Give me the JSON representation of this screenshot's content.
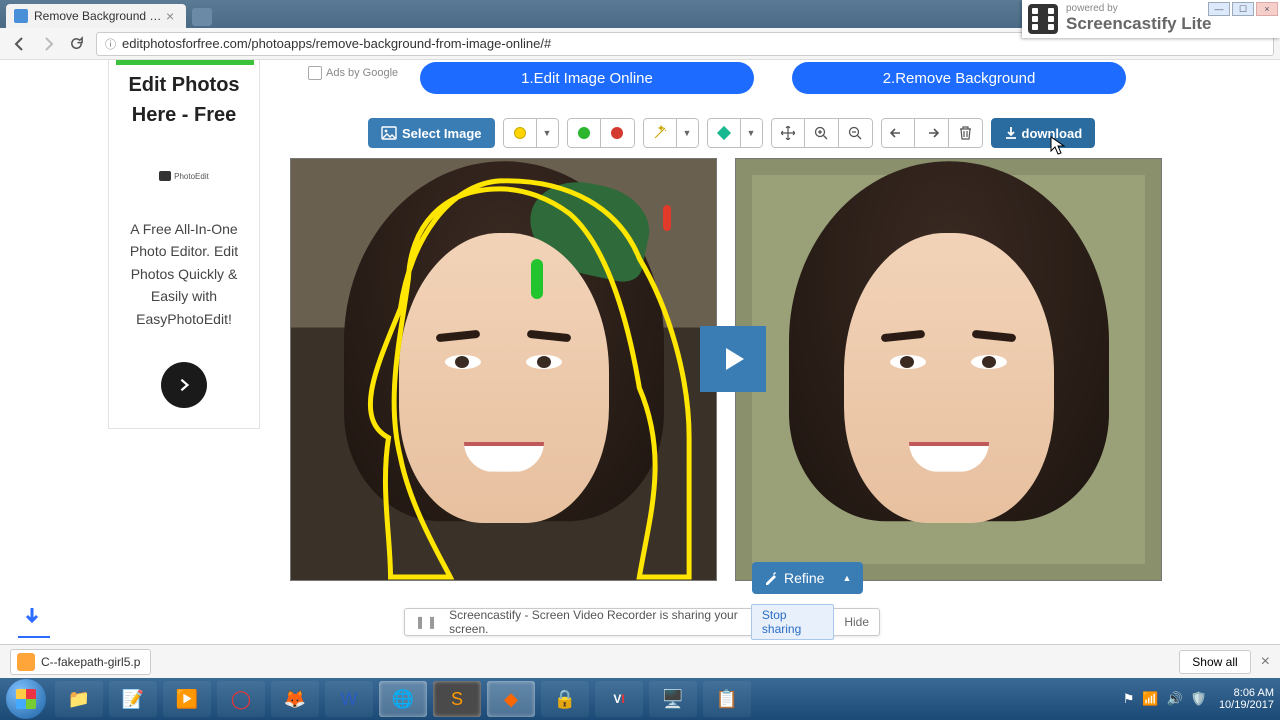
{
  "browser": {
    "tab_title": "Remove Background Fro",
    "url": "editphotosforfree.com/photoapps/remove-background-from-image-online/#"
  },
  "sidebar": {
    "title_line1": "Edit Photos",
    "title_line2": "Here - Free",
    "logo_text": "PhotoEdit",
    "desc": "A Free All-In-One Photo Editor. Edit Photos Quickly & Easily with EasyPhotoEdit!"
  },
  "ads_label": "Ads by Google",
  "steps": {
    "one": "1.Edit Image Online",
    "two": "2.Remove Background"
  },
  "toolbar": {
    "select_image": "Select Image",
    "download": "download"
  },
  "refine_label": "Refine",
  "share_banner": {
    "text": "Screencastify - Screen Video Recorder is sharing your screen.",
    "stop": "Stop sharing",
    "hide": "Hide"
  },
  "shelf": {
    "file": "C--fakepath-girl5.p",
    "showall": "Show all"
  },
  "castify": {
    "powered": "powered by",
    "name": "Screencastify Lite"
  },
  "tray": {
    "time": "8:06 AM",
    "date": "10/19/2017"
  }
}
